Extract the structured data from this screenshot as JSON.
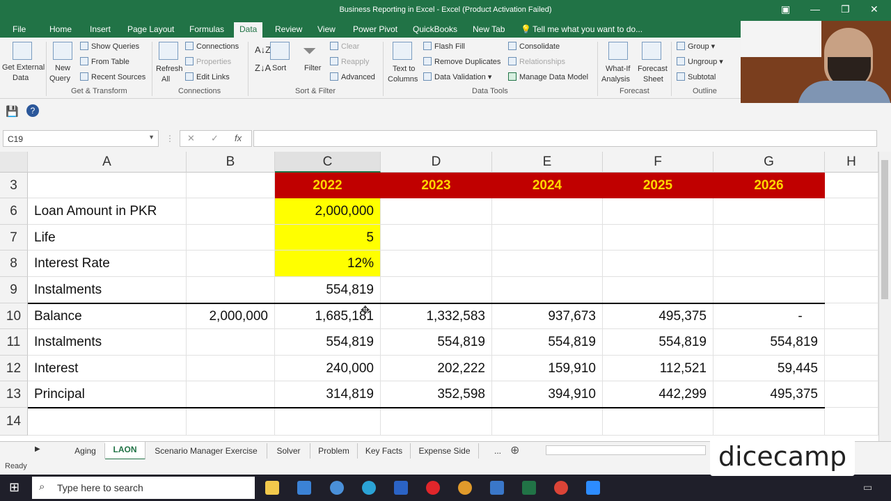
{
  "window": {
    "title": "Business Reporting in Excel - Excel (Product Activation Failed)"
  },
  "tabs": [
    "File",
    "Home",
    "Insert",
    "Page Layout",
    "Formulas",
    "Data",
    "Review",
    "View",
    "Power Pivot",
    "QuickBooks",
    "New Tab"
  ],
  "tell_me": "Tell me what you want to do...",
  "ribbon": {
    "get_external": "Get External",
    "data_dd": "Data",
    "new_query": "New",
    "query_dd": "Query",
    "show_queries": "Show Queries",
    "from_table": "From Table",
    "recent_sources": "Recent Sources",
    "get_transform": "Get & Transform",
    "refresh": "Refresh",
    "all_dd": "All",
    "connections": "Connections",
    "properties": "Properties",
    "edit_links": "Edit Links",
    "connections_group": "Connections",
    "sort": "Sort",
    "filter": "Filter",
    "clear": "Clear",
    "reapply": "Reapply",
    "advanced": "Advanced",
    "sort_filter_group": "Sort & Filter",
    "text_to": "Text to",
    "columns": "Columns",
    "flash_fill": "Flash Fill",
    "remove_duplicates": "Remove Duplicates",
    "data_validation": "Data Validation",
    "consolidate": "Consolidate",
    "relationships": "Relationships",
    "manage_data_model": "Manage Data Model",
    "data_tools_group": "Data Tools",
    "what_if": "What-If",
    "analysis": "Analysis",
    "forecast": "Forecast",
    "sheet": "Sheet",
    "forecast_group": "Forecast",
    "group": "Group",
    "ungroup": "Ungroup",
    "subtotal": "Subtotal",
    "outline_group": "Outline"
  },
  "name_box": "C19",
  "fx": "fx",
  "columns": [
    "A",
    "B",
    "C",
    "D",
    "E",
    "F",
    "G",
    "H"
  ],
  "rows": [
    {
      "num": "3",
      "cells": [
        "",
        "",
        "2022",
        "2023",
        "2024",
        "2025",
        "2026"
      ]
    },
    {
      "num": "6",
      "cells": [
        "Loan Amount in PKR",
        "",
        "2,000,000",
        "",
        "",
        "",
        ""
      ]
    },
    {
      "num": "7",
      "cells": [
        "Life",
        "",
        "5",
        "",
        "",
        "",
        ""
      ]
    },
    {
      "num": "8",
      "cells": [
        "Interest Rate",
        "",
        "12%",
        "",
        "",
        "",
        ""
      ]
    },
    {
      "num": "9",
      "cells": [
        "Instalments",
        "",
        "554,819",
        "",
        "",
        "",
        ""
      ]
    },
    {
      "num": "10",
      "cells": [
        "Balance",
        "2,000,000",
        "1,685,181",
        "1,332,583",
        "937,673",
        "495,375",
        "-"
      ]
    },
    {
      "num": "11",
      "cells": [
        "Instalments",
        "",
        "554,819",
        "554,819",
        "554,819",
        "554,819",
        "554,819"
      ]
    },
    {
      "num": "12",
      "cells": [
        "Interest",
        "",
        "240,000",
        "202,222",
        "159,910",
        "112,521",
        "59,445"
      ]
    },
    {
      "num": "13",
      "cells": [
        "Principal",
        "",
        "314,819",
        "352,598",
        "394,910",
        "442,299",
        "495,375"
      ]
    },
    {
      "num": "14",
      "cells": [
        "",
        "",
        "",
        "",
        "",
        "",
        ""
      ]
    }
  ],
  "sheets": [
    "Aging",
    "LAON",
    "Scenario Manager Exercise",
    "Solver",
    "Problem",
    "Key Facts",
    "Expense Side",
    "..."
  ],
  "status": "Ready",
  "taskbar": {
    "search_placeholder": "Type here to search"
  },
  "logo": "dicecamp",
  "colors": {
    "excel_green": "#217346",
    "header_red": "#c00000",
    "header_gold": "#ffd700",
    "input_yellow": "#ffff00"
  }
}
